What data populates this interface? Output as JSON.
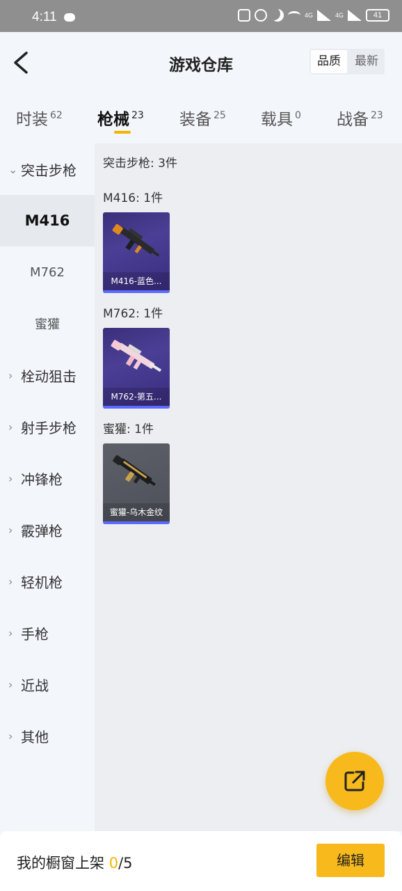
{
  "status_bar": {
    "time": "4:11",
    "battery": "41",
    "network_1": "4G",
    "network_2": "4G"
  },
  "header": {
    "title": "游戏仓库",
    "sort_quality": "品质",
    "sort_newest": "最新"
  },
  "tabs": [
    {
      "label": "时装",
      "count": "62"
    },
    {
      "label": "枪械",
      "count": "23"
    },
    {
      "label": "装备",
      "count": "25"
    },
    {
      "label": "载具",
      "count": "0"
    },
    {
      "label": "战备",
      "count": "23"
    }
  ],
  "sidebar": {
    "groups": [
      {
        "label": "突击步枪",
        "expanded": true
      },
      {
        "label": "栓动狙击"
      },
      {
        "label": "射手步枪"
      },
      {
        "label": "冲锋枪"
      },
      {
        "label": "霰弹枪"
      },
      {
        "label": "轻机枪"
      },
      {
        "label": "手枪"
      },
      {
        "label": "近战"
      },
      {
        "label": "其他"
      }
    ],
    "subitems": [
      {
        "label": "M416",
        "active": true
      },
      {
        "label": "M762"
      },
      {
        "label": "蜜獾"
      }
    ]
  },
  "content": {
    "category_summary": "突击步枪: 3件",
    "sections": [
      {
        "title": "M416: 1件",
        "item_label": "M416-蓝色..."
      },
      {
        "title": "M762: 1件",
        "item_label": "M762-第五..."
      },
      {
        "title": "蜜獾: 1件",
        "item_label": "蜜獾-乌木金纹"
      }
    ]
  },
  "bottom_bar": {
    "showcase_label": "我的橱窗上架",
    "showcase_count": "0",
    "showcase_total": "/5",
    "edit_label": "编辑"
  },
  "colors": {
    "accent": "#f7b91c",
    "card_blue": "#3b2f7a",
    "card_grey": "#5d6068"
  },
  "icons": {
    "back": "chevron-left-icon",
    "fab": "share-external-icon"
  }
}
